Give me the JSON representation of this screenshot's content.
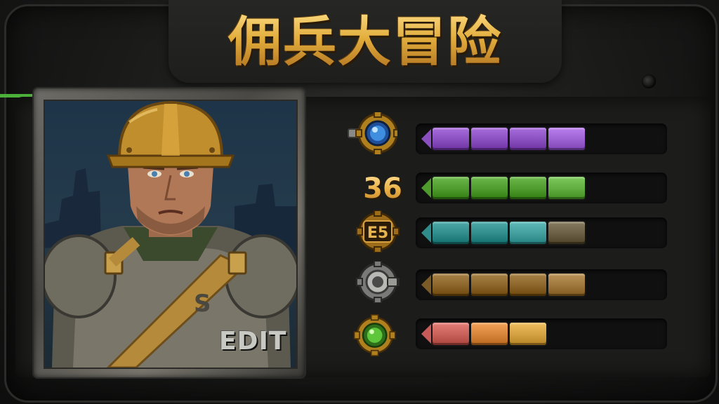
{
  "title": "佣兵大冒险",
  "portrait": {
    "edit_label": "EDIT"
  },
  "stats": [
    {
      "icon": "blue-gem-gear-icon",
      "level_text": null,
      "filled": 4,
      "capacity": 4,
      "color": "#8a4fbf",
      "tip_color": "#8a4fbf"
    },
    {
      "icon": null,
      "level_text": "36",
      "filled": 4,
      "capacity": 4,
      "color": "#4e9a2c",
      "tip_color": "#4e9a2c"
    },
    {
      "icon": "e5-badge-gear-icon",
      "level_text": null,
      "filled": 3,
      "capacity": 4,
      "color": "#2f8c8a",
      "tip_color": "#2f8c8a"
    },
    {
      "icon": "silver-gear-icon",
      "level_text": null,
      "filled": 4,
      "capacity": 4,
      "color": "#8a6428",
      "tip_color": "#7a5a26"
    },
    {
      "icon": "green-gem-gear-icon",
      "level_text": null,
      "filled": 3,
      "capacity": 3,
      "color": "#d68a3a",
      "tip_color": "#c85a5a"
    }
  ],
  "icon_badge_text": "E5",
  "colors": {
    "title_gold": "#e0b24a",
    "panel_dark": "#1c1c1b",
    "accent_green": "#4caf3a"
  }
}
